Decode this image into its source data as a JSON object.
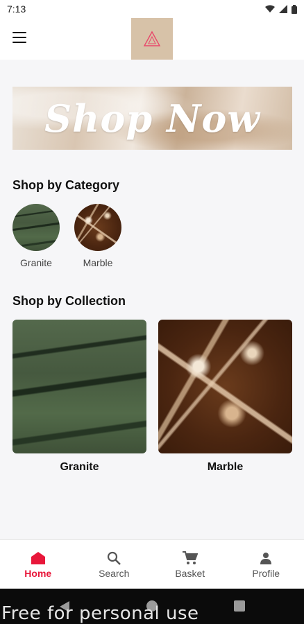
{
  "status_bar": {
    "time": "7:13"
  },
  "banner": {
    "text": "Shop Now"
  },
  "category_section": {
    "title": "Shop by Category",
    "items": [
      {
        "label": "Granite"
      },
      {
        "label": "Marble"
      }
    ]
  },
  "collection_section": {
    "title": "Shop by Collection",
    "items": [
      {
        "label": "Granite"
      },
      {
        "label": "Marble"
      }
    ]
  },
  "bottom_nav": {
    "items": [
      {
        "label": "Home",
        "icon": "home-icon",
        "active": true
      },
      {
        "label": "Search",
        "icon": "search-icon",
        "active": false
      },
      {
        "label": "Basket",
        "icon": "cart-icon",
        "active": false
      },
      {
        "label": "Profile",
        "icon": "person-icon",
        "active": false
      }
    ]
  },
  "watermark": "Free for personal use",
  "colors": {
    "accent": "#e8173a",
    "logo_bg": "#d7c2a8",
    "background": "#f6f6f8"
  }
}
